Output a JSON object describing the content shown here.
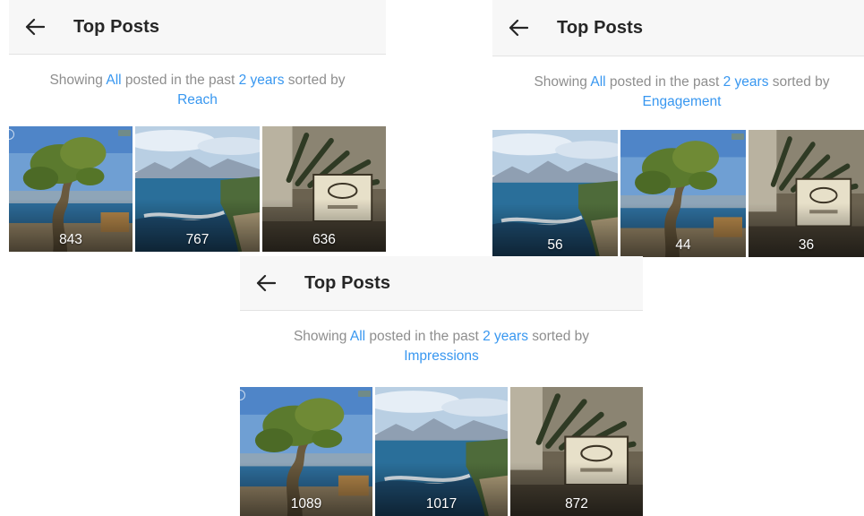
{
  "panels": [
    {
      "id": "reach",
      "header": {
        "title": "Top Posts",
        "back_icon": "arrow-left-icon"
      },
      "caption": {
        "prefix": "Showing ",
        "filter": "All",
        "middle": " posted in the past ",
        "range": "2 years",
        "suffix": " sorted by",
        "sort": "Reach"
      },
      "posts": [
        {
          "image": "olive-tree",
          "count": "843"
        },
        {
          "image": "coast",
          "count": "767"
        },
        {
          "image": "soap-box",
          "count": "636"
        }
      ]
    },
    {
      "id": "engagement",
      "header": {
        "title": "Top Posts",
        "back_icon": "arrow-left-icon"
      },
      "caption": {
        "prefix": "Showing ",
        "filter": "All",
        "middle": " posted in the past ",
        "range": "2 years",
        "suffix": " sorted by",
        "sort": "Engagement"
      },
      "posts": [
        {
          "image": "coast",
          "count": "56"
        },
        {
          "image": "olive-tree",
          "count": "44"
        },
        {
          "image": "soap-box",
          "count": "36"
        }
      ]
    },
    {
      "id": "impressions",
      "header": {
        "title": "Top Posts",
        "back_icon": "arrow-left-icon"
      },
      "caption": {
        "prefix": "Showing ",
        "filter": "All",
        "middle": " posted in the past ",
        "range": "2 years",
        "suffix": " sorted by",
        "sort": "Impressions"
      },
      "posts": [
        {
          "image": "olive-tree",
          "count": "1089"
        },
        {
          "image": "coast",
          "count": "1017"
        },
        {
          "image": "soap-box",
          "count": "872"
        }
      ]
    }
  ],
  "colors": {
    "link": "#3897f0",
    "caption_text": "#8e8e8e",
    "title_text": "#262626",
    "header_bg": "#f7f7f7"
  }
}
